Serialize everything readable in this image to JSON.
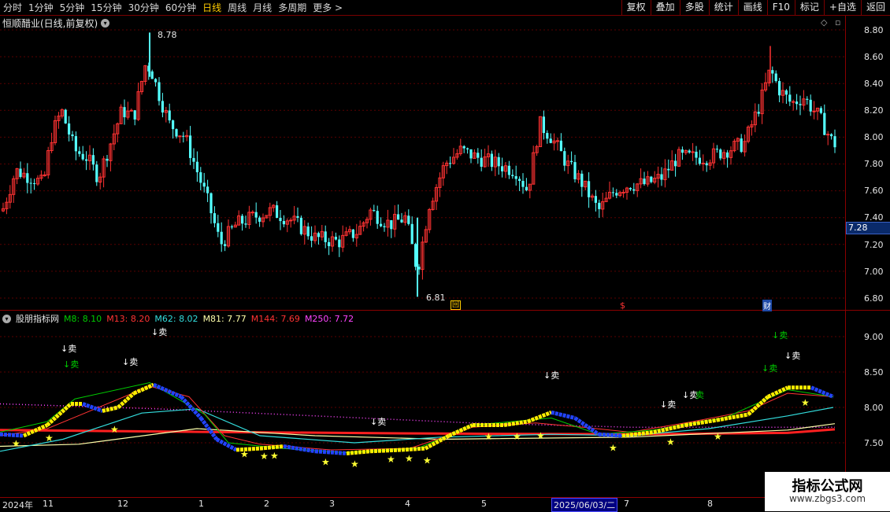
{
  "toolbar": {
    "tabs": [
      "分时",
      "1分钟",
      "5分钟",
      "15分钟",
      "30分钟",
      "60分钟",
      "日线",
      "周线",
      "月线",
      "多周期",
      "更多 >"
    ],
    "active_tab": "日线",
    "right_buttons": [
      "复权",
      "叠加",
      "多股",
      "统计",
      "画线",
      "F10",
      "标记",
      "+自选",
      "返回"
    ]
  },
  "chart_title": "恒顺醋业(日线,前复权)",
  "price_axis": [
    "8.80",
    "8.60",
    "8.40",
    "8.20",
    "8.00",
    "7.80",
    "7.60",
    "7.40",
    "7.20",
    "7.00",
    "6.80"
  ],
  "current_price": "7.28",
  "high_marker": "8.78",
  "low_marker": "6.81",
  "event_marks": [
    "回",
    "$",
    "财"
  ],
  "indicator": {
    "name": "股朋指标网",
    "m8": "M8: 8.10",
    "m13": "M13: 8.20",
    "m62": "M62: 8.02",
    "m81": "M81: 7.77",
    "m144": "M144: 7.69",
    "m250": "M250: 7.72",
    "axis": [
      "9.00",
      "8.50",
      "8.00",
      "7.50"
    ],
    "sell_label": "卖",
    "colors": {
      "m8": "#00cc00",
      "m13": "#ff3333",
      "m62": "#33dddd",
      "m81": "#ffffaa",
      "m144": "#ff3333",
      "m250": "#ff44ff"
    }
  },
  "dates": [
    "2024年",
    "11",
    "12",
    "1",
    "2",
    "3",
    "4",
    "5",
    "2025/06/03/二",
    "7",
    "8"
  ],
  "watermark": {
    "title": "指标公式网",
    "url": "www.zbgs3.com"
  },
  "icons": [
    "chevron-down-icon",
    "diamond-icon",
    "square-icon"
  ]
}
